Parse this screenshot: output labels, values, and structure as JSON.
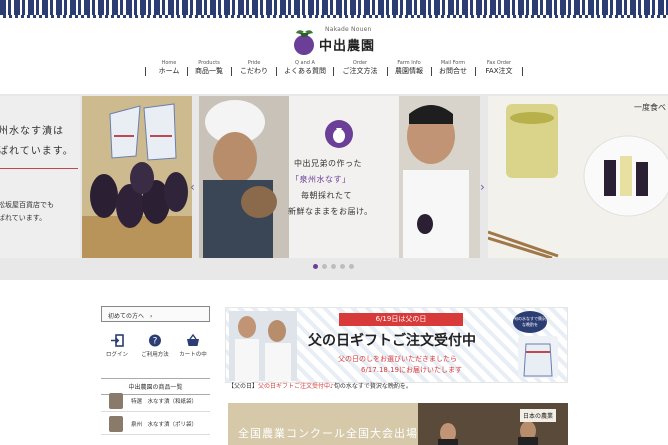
{
  "logo": {
    "romaji": "Nakade Nouen",
    "name": "中出農園"
  },
  "nav": [
    {
      "en": "Home",
      "jp": "ホーム"
    },
    {
      "en": "Products",
      "jp": "商品一覧"
    },
    {
      "en": "Pride",
      "jp": "こだわり"
    },
    {
      "en": "Q and A",
      "jp": "よくある質問"
    },
    {
      "en": "Order",
      "jp": "ご注文方法"
    },
    {
      "en": "Farm Info",
      "jp": "農園情報"
    },
    {
      "en": "Mail Form",
      "jp": "お問合せ"
    },
    {
      "en": "Fax Order",
      "jp": "FAX注文"
    }
  ],
  "hero": {
    "left": {
      "line1": "州水なす漬は",
      "line2": "ばれています。",
      "line3": "松坂屋百貨店でも",
      "line4": "ばれています。"
    },
    "main": {
      "line1": "中出兄弟の作った",
      "line2": "「泉州水なす」",
      "line3": "毎朝採れたて",
      "line4": "新鮮なままをお届け。"
    },
    "right": {
      "line1": "一度食べ"
    },
    "prev_arrow": "‹",
    "next_arrow": "›",
    "dots": 5,
    "active_dot": 0
  },
  "sidebar": {
    "beginner": "初めての方へ　›",
    "quick_links": [
      {
        "label": "ログイン",
        "icon": "login-icon"
      },
      {
        "label": "ご利用方法",
        "icon": "help-icon"
      },
      {
        "label": "カートの中",
        "icon": "cart-icon"
      }
    ],
    "products_heading": "中出農園の商品一覧",
    "products": [
      {
        "label": "特選　水なす漬（和紙袋）"
      },
      {
        "label": "泉州　水なす漬（ポリ袋）"
      }
    ]
  },
  "banner": {
    "tag": "6/19日は父の日",
    "title": "父の日ギフトご注文受付中",
    "sub1": "父の日のしをお選びいただきましたら",
    "sub2": "6/17.18.19にお届けいたします",
    "badge": "旬の水なすで贅沢な晩酌を"
  },
  "caption": {
    "prefix": "【父の日】",
    "red": "父の日ギフトご注文受付中♪",
    "rest": "旬の水なすで贅沢な晩酌を。"
  },
  "banner2": {
    "text": "全国農業コンクール全国大会出場",
    "tag": "日本の農業"
  },
  "colors": {
    "brand_navy": "#2b3d73",
    "brand_purple": "#6b3f97",
    "accent_red": "#d83a3a"
  }
}
